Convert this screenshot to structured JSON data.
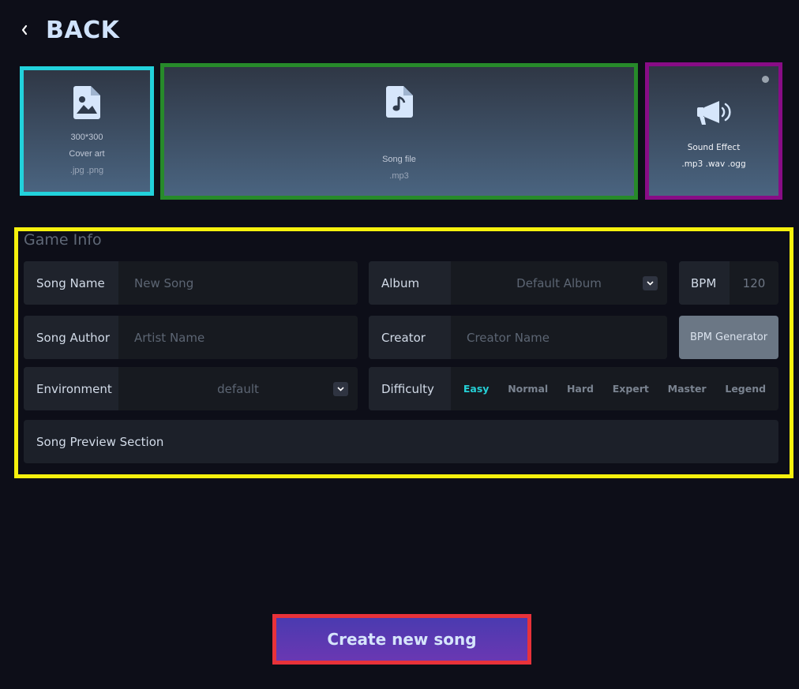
{
  "nav": {
    "back_label": "BACK"
  },
  "uploads": {
    "cover": {
      "size": "300*300",
      "title": "Cover art",
      "formats": ".jpg .png"
    },
    "song": {
      "title": "Song file",
      "formats": ".mp3"
    },
    "sound_effect": {
      "title": "Sound Effect",
      "formats": ".mp3 .wav .ogg"
    }
  },
  "game_info": {
    "heading": "Game Info",
    "song_name": {
      "label": "Song Name",
      "placeholder": "New Song"
    },
    "album": {
      "label": "Album",
      "value": "Default Album"
    },
    "bpm": {
      "label": "BPM",
      "value": "120"
    },
    "song_author": {
      "label": "Song Author",
      "placeholder": "Artist Name"
    },
    "creator": {
      "label": "Creator",
      "placeholder": "Creator Name"
    },
    "bpm_generator": {
      "label": "BPM Generator"
    },
    "environment": {
      "label": "Environment",
      "value": "default"
    },
    "difficulty": {
      "label": "Difficulty",
      "selected": "Easy",
      "options": [
        "Easy",
        "Normal",
        "Hard",
        "Expert",
        "Master",
        "Legend"
      ]
    },
    "preview": {
      "label": "Song Preview Section"
    }
  },
  "actions": {
    "create_label": "Create new song"
  },
  "colors": {
    "background": "#0d0e18",
    "cover_outline": "#22d2dc",
    "song_outline": "#278a2a",
    "sfx_outline": "#880c86",
    "info_outline": "#f6f10d",
    "create_outline": "#e8323a",
    "accent": "#25d0d6"
  },
  "icons": {
    "back": "chevron-left-icon",
    "cover": "image-file-icon",
    "song": "music-file-icon",
    "sfx": "megaphone-icon",
    "select": "chevron-down-icon"
  }
}
